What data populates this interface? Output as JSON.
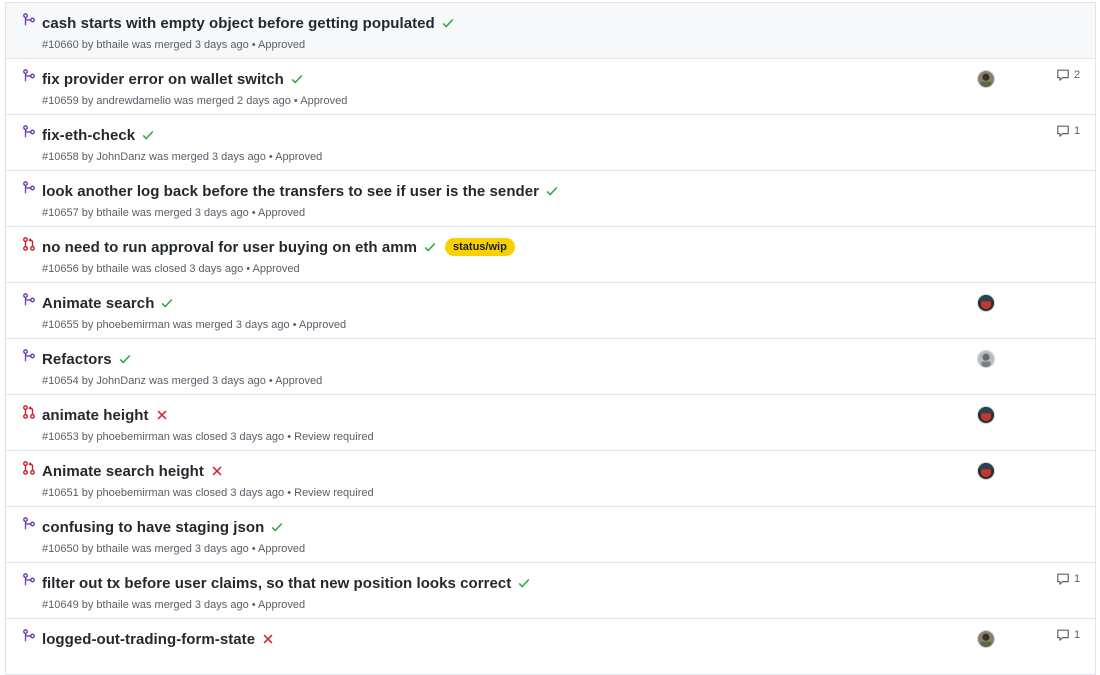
{
  "colors": {
    "merged": "#6f42c1",
    "closed": "#cb2431",
    "check": "#28a745",
    "cross": "#cb2431",
    "badge": "#f9d001"
  },
  "pull_requests": [
    {
      "title": "cash starts with empty object before getting populated",
      "status_mark": "check",
      "state": "merged",
      "meta": "#10660 by bthaile was merged 3 days ago • Approved",
      "avatar": null,
      "comments": null,
      "label": null
    },
    {
      "title": "fix provider error on wallet switch",
      "status_mark": "check",
      "state": "merged",
      "meta": "#10659 by andrewdamelio was merged 2 days ago • Approved",
      "avatar": "avatar-a",
      "comments": "2",
      "label": null
    },
    {
      "title": "fix-eth-check",
      "status_mark": "check",
      "state": "merged",
      "meta": "#10658 by JohnDanz was merged 3 days ago • Approved",
      "avatar": null,
      "comments": "1",
      "label": null
    },
    {
      "title": "look another log back before the transfers to see if user is the sender",
      "status_mark": "check",
      "state": "merged",
      "meta": "#10657 by bthaile was merged 3 days ago • Approved",
      "avatar": null,
      "comments": null,
      "label": null
    },
    {
      "title": "no need to run approval for user buying on eth amm",
      "status_mark": "check",
      "state": "closed",
      "meta": "#10656 by bthaile was closed 3 days ago • Approved",
      "avatar": null,
      "comments": null,
      "label": "status/wip"
    },
    {
      "title": "Animate search",
      "status_mark": "check",
      "state": "merged",
      "meta": "#10655 by phoebemirman was merged 3 days ago • Approved",
      "avatar": "avatar-p",
      "comments": null,
      "label": null
    },
    {
      "title": "Refactors",
      "status_mark": "check",
      "state": "merged",
      "meta": "#10654 by JohnDanz was merged 3 days ago • Approved",
      "avatar": "avatar-j",
      "comments": null,
      "label": null
    },
    {
      "title": "animate height",
      "status_mark": "cross",
      "state": "closed",
      "meta": "#10653 by phoebemirman was closed 3 days ago • Review required",
      "avatar": "avatar-p",
      "comments": null,
      "label": null
    },
    {
      "title": "Animate search height",
      "status_mark": "cross",
      "state": "closed",
      "meta": "#10651 by phoebemirman was closed 3 days ago • Review required",
      "avatar": "avatar-p",
      "comments": null,
      "label": null
    },
    {
      "title": "confusing to have staging json",
      "status_mark": "check",
      "state": "merged",
      "meta": "#10650 by bthaile was merged 3 days ago • Approved",
      "avatar": null,
      "comments": null,
      "label": null
    },
    {
      "title": "filter out tx before user claims, so that new position looks correct",
      "status_mark": "check",
      "state": "merged",
      "meta": "#10649 by bthaile was merged 3 days ago • Approved",
      "avatar": null,
      "comments": "1",
      "label": null
    },
    {
      "title": "logged-out-trading-form-state",
      "status_mark": "cross",
      "state": "merged",
      "meta": "",
      "avatar": "avatar-a",
      "comments": "1",
      "label": null
    }
  ]
}
